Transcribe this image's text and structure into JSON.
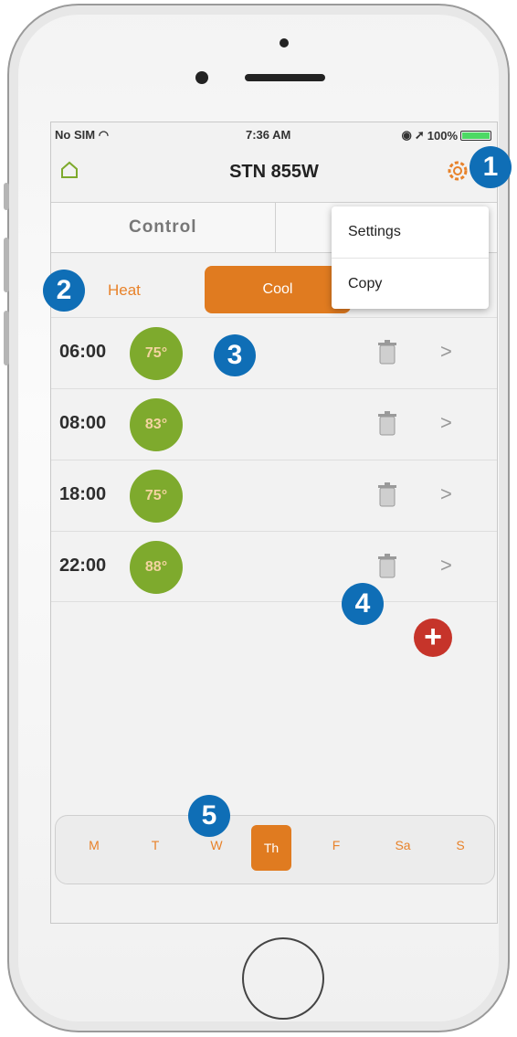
{
  "status_bar": {
    "carrier": "No SIM",
    "time": "7:36 AM",
    "battery": "100%"
  },
  "nav": {
    "title": "STN 855W"
  },
  "segments": [
    "Control",
    ""
  ],
  "modes": {
    "heat": "Heat",
    "cool": "Cool"
  },
  "schedule": [
    {
      "time": "06:00",
      "temp": "75°"
    },
    {
      "time": "08:00",
      "temp": "83°"
    },
    {
      "time": "18:00",
      "temp": "75°"
    },
    {
      "time": "22:00",
      "temp": "88°"
    }
  ],
  "row_arrow": ">",
  "add_symbol": "+",
  "days": [
    "M",
    "T",
    "W",
    "Th",
    "F",
    "Sa",
    "S"
  ],
  "active_day": "Th",
  "menu": {
    "items": [
      "Settings",
      "Copy"
    ]
  },
  "callouts": [
    "1",
    "2",
    "3",
    "4",
    "5"
  ],
  "colors": {
    "accent": "#e07b20",
    "temp_bubble": "#7eaa2d",
    "add": "#c6342a",
    "callout": "#0f6eb6"
  }
}
